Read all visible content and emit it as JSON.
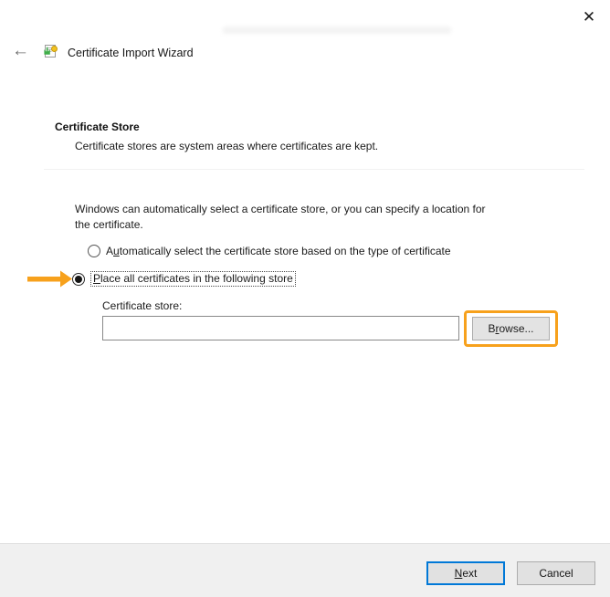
{
  "window": {
    "close_icon": "✕",
    "back_icon": "←",
    "title": "Certificate Import Wizard"
  },
  "content": {
    "section_heading": "Certificate Store",
    "section_subtitle": "Certificate stores are system areas where certificates are kept.",
    "intro_line1": "Windows can automatically select a certificate store, or you can specify a location for",
    "intro_line2": "the certificate.",
    "radio_auto": {
      "selected": false,
      "pre": "A",
      "accesskey": "u",
      "post": "tomatically select the certificate store based on the type of certificate"
    },
    "radio_place": {
      "selected": true,
      "pre": "",
      "accesskey": "P",
      "post": "lace all certificates in the following store"
    },
    "store_field": {
      "label": "Certificate store:",
      "value": ""
    }
  },
  "buttons": {
    "browse": {
      "pre": "B",
      "accesskey": "r",
      "post": "owse..."
    },
    "next": {
      "pre": "",
      "accesskey": "N",
      "post": "ext"
    },
    "cancel_label": "Cancel"
  },
  "annotations": {
    "arrow_color": "#F7A11C",
    "highlight_color": "#F7A11C"
  },
  "colors": {
    "focus_blue": "#0078D7",
    "button_bg": "#E1E1E1",
    "footer_bg": "#F0F0F0"
  }
}
